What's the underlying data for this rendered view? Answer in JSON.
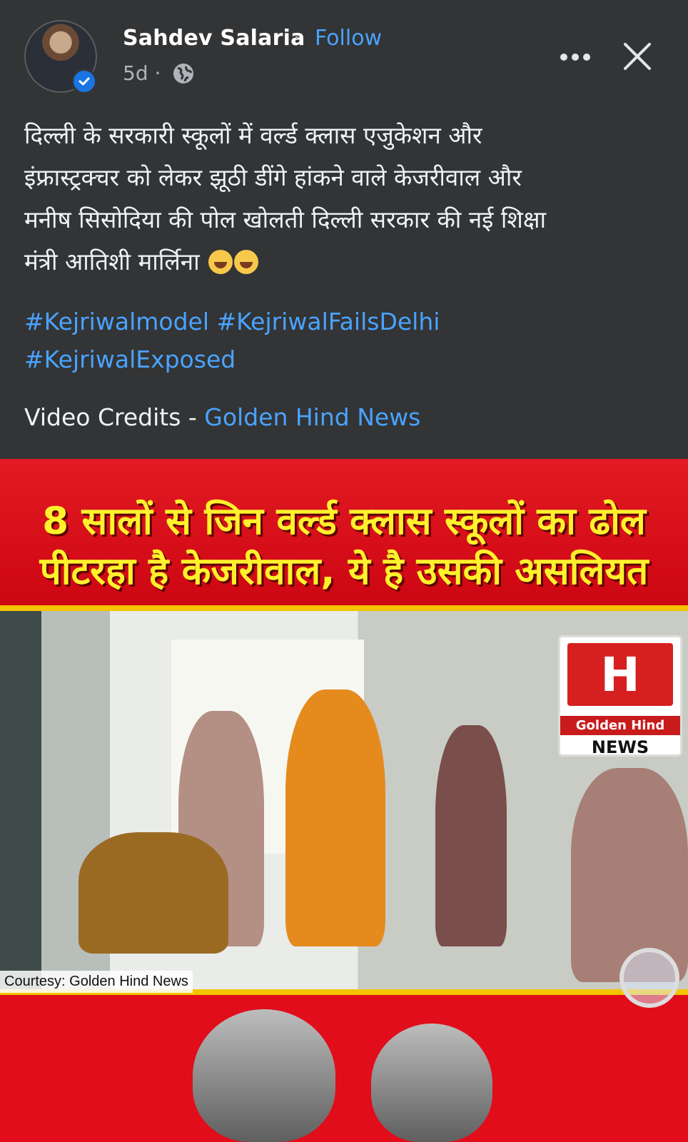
{
  "post": {
    "author": "Sahdev Salaria",
    "separator": "·",
    "follow_label": "Follow",
    "timestamp": "5d ·",
    "privacy_icon": "globe-icon",
    "body_line1": "दिल्ली के सरकारी स्कूलों में वर्ल्ड क्लास एजुकेशन और",
    "body_line2": "इंफ्रास्ट्रक्चर को लेकर झूठी डींगे हांकने वाले केजरीवाल और",
    "body_line3": "मनीष सिसोदिया की पोल खोलती दिल्ली सरकार की नई शिक्षा",
    "body_line4": "मंत्री आतिशी मार्लिना",
    "hashtag1": "#Kejriwalmodel",
    "hashtag2": "#KejriwalFailsDelhi",
    "hashtag3": "#KejriwalExposed",
    "credits_label": "Video Credits - ",
    "credits_link": "Golden Hind News"
  },
  "media": {
    "headline_line1": "8 सालों से जिन वर्ल्ड क्लास स्कूलों का ढोल",
    "headline_line2": "पीटरहा है केजरीवाल, ये है उसकी असलियत",
    "logo_letter": "H",
    "logo_name": "Golden Hind",
    "logo_news": "NEWS",
    "courtesy": "Courtesy: Golden Hind News"
  },
  "colors": {
    "background": "#323436",
    "link": "#4aa3ff",
    "banner_red": "#e31a23",
    "banner_text": "#fff12c",
    "verified": "#1b74e4"
  }
}
